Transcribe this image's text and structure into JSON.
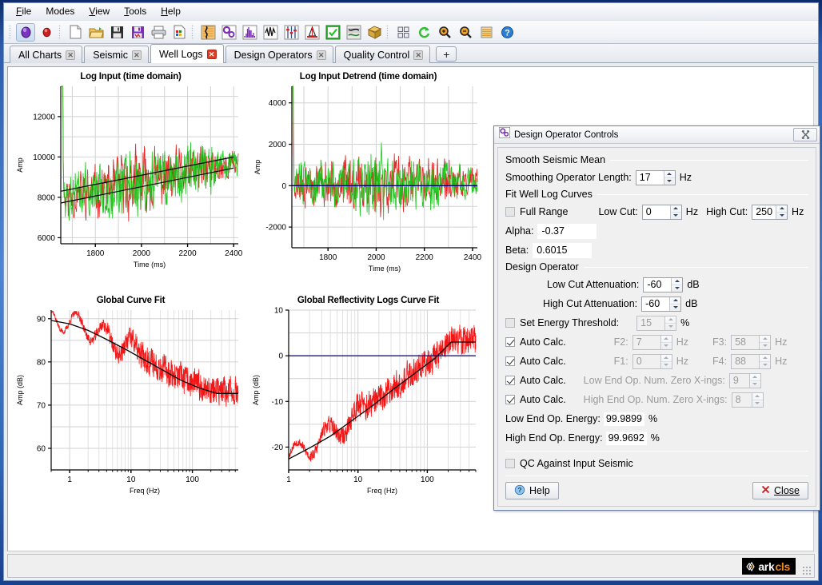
{
  "window": {
    "menubar": [
      {
        "label": "File",
        "mnemonic": "F"
      },
      {
        "label": "Modes",
        "mnemonic": ""
      },
      {
        "label": "View",
        "mnemonic": "V"
      },
      {
        "label": "Tools",
        "mnemonic": "T"
      },
      {
        "label": "Help",
        "mnemonic": "H"
      }
    ],
    "toolbar": [
      {
        "name": "record-purple-button",
        "selected": true
      },
      {
        "name": "record-red-button",
        "selected": false
      },
      {
        "name": "new-file-button",
        "selected": false
      },
      {
        "name": "open-folder-button",
        "selected": false
      },
      {
        "name": "save-button",
        "selected": false
      },
      {
        "name": "save-as-button",
        "selected": false
      },
      {
        "name": "print-button",
        "selected": false
      },
      {
        "name": "report-button",
        "selected": false
      },
      {
        "name": "seismic-trace-button",
        "selected": false
      },
      {
        "name": "settings-gears-button",
        "selected": false
      },
      {
        "name": "spectrum-button",
        "selected": false
      },
      {
        "name": "wavelet-button",
        "selected": false
      },
      {
        "name": "operator-button",
        "selected": false
      },
      {
        "name": "well-derrick-button",
        "selected": false
      },
      {
        "name": "quality-check-button",
        "selected": false
      },
      {
        "name": "design-operator-button",
        "selected": false
      },
      {
        "name": "volume-stack-button",
        "selected": false
      },
      {
        "name": "tile-layout-button",
        "selected": false
      },
      {
        "name": "refresh-button",
        "selected": false
      },
      {
        "name": "zoom-in-button",
        "selected": false
      },
      {
        "name": "zoom-out-button",
        "selected": false
      },
      {
        "name": "list-button",
        "selected": false
      },
      {
        "name": "about-help-button",
        "selected": false
      }
    ],
    "tabs": [
      {
        "label": "All Charts",
        "active": false,
        "closable": true
      },
      {
        "label": "Seismic",
        "active": false,
        "closable": true
      },
      {
        "label": "Well Logs",
        "active": true,
        "closable": true
      },
      {
        "label": "Design Operators",
        "active": false,
        "closable": true
      },
      {
        "label": "Quality Control",
        "active": false,
        "closable": true
      }
    ],
    "tab_add_label": "+",
    "statusbar": {
      "brand_part1": "ark",
      "brand_part2": "cls"
    }
  },
  "chart_data": [
    {
      "type": "line",
      "id": "log-input-time",
      "title": "Log Input (time domain)",
      "xlabel": "Time (ms)",
      "ylabel": "Amp",
      "xlim": [
        1650,
        2420
      ],
      "ylim": [
        5700,
        13500
      ],
      "xticks": [
        1800,
        2000,
        2200,
        2400
      ],
      "yticks": [
        6000,
        8000,
        10000,
        12000
      ],
      "xscale": "linear",
      "yscale": "linear",
      "grid": true,
      "series": [
        {
          "name": "log-curve-red",
          "color": "#e01b1b",
          "style": "noisy"
        },
        {
          "name": "log-curve-green",
          "color": "#16c516",
          "style": "noisy"
        },
        {
          "name": "trend-fit-upper",
          "color": "#000000",
          "style": "trend"
        },
        {
          "name": "trend-fit-lower",
          "color": "#000000",
          "style": "trend"
        }
      ],
      "trend_upper": {
        "x0": 1650,
        "y0": 8300,
        "x1": 2400,
        "y1": 10000
      },
      "trend_lower": {
        "x0": 1650,
        "y0": 7720,
        "x1": 2400,
        "y1": 9450
      }
    },
    {
      "type": "line",
      "id": "log-input-detrend",
      "title": "Log Input Detrend (time domain)",
      "xlabel": "Time (ms)",
      "ylabel": "Amp",
      "xlim": [
        1650,
        2420
      ],
      "ylim": [
        -3000,
        4800
      ],
      "xticks": [
        1800,
        2000,
        2200,
        2400
      ],
      "yticks": [
        -2000,
        0,
        2000,
        4000
      ],
      "xscale": "linear",
      "yscale": "linear",
      "grid": true,
      "series": [
        {
          "name": "detrend-red",
          "color": "#e01b1b",
          "style": "noisy"
        },
        {
          "name": "detrend-green",
          "color": "#16c516",
          "style": "noisy"
        },
        {
          "name": "zero-line",
          "color": "#000080",
          "style": "hline",
          "value": 0
        }
      ]
    },
    {
      "type": "line",
      "id": "global-curve-fit",
      "title": "Global Curve Fit",
      "xlabel": "Freq (Hz)",
      "ylabel": "Amp (dB)",
      "xlim": [
        0.5,
        560
      ],
      "ylim": [
        55,
        92
      ],
      "xticks": [
        1,
        10,
        100
      ],
      "yticks": [
        60,
        70,
        80,
        90
      ],
      "xscale": "log",
      "yscale": "linear",
      "grid": true,
      "series": [
        {
          "name": "spectrum-red",
          "color": "#f41616",
          "style": "spectrum"
        },
        {
          "name": "global-fit-black",
          "color": "#000000",
          "style": "fit"
        }
      ],
      "fit_points": [
        [
          0.5,
          89.6
        ],
        [
          1,
          88.8
        ],
        [
          2,
          87.3
        ],
        [
          4,
          85.2
        ],
        [
          8,
          83.0
        ],
        [
          16,
          80.6
        ],
        [
          32,
          78.2
        ],
        [
          64,
          75.8
        ],
        [
          128,
          74.0
        ],
        [
          250,
          72.7
        ],
        [
          560,
          72.7
        ]
      ]
    },
    {
      "type": "line",
      "id": "global-reflectivity-logs-curve-fit",
      "title": "Global Reflectivity Logs Curve Fit",
      "xlabel": "Freq (Hz)",
      "ylabel": "Amp (dB)",
      "xlim": [
        1,
        500
      ],
      "ylim": [
        -25,
        10
      ],
      "xticks": [
        1,
        10,
        100
      ],
      "yticks": [
        -20,
        -10,
        0,
        10
      ],
      "xscale": "log",
      "yscale": "linear",
      "grid": true,
      "series": [
        {
          "name": "reflectivity-red",
          "color": "#f41616",
          "style": "spectrum"
        },
        {
          "name": "reflectivity-fit-black",
          "color": "#000000",
          "style": "fit"
        },
        {
          "name": "zero-line",
          "color": "#000080",
          "style": "hline",
          "value": 0
        }
      ],
      "fit_points": [
        [
          1,
          -22.6
        ],
        [
          2,
          -20.2
        ],
        [
          4,
          -17.6
        ],
        [
          8,
          -14.3
        ],
        [
          16,
          -11.0
        ],
        [
          32,
          -7.4
        ],
        [
          64,
          -4.0
        ],
        [
          128,
          -0.6
        ],
        [
          220,
          3.0
        ],
        [
          500,
          3.0
        ]
      ]
    }
  ],
  "dialog": {
    "title": "Design Operator Controls",
    "icon": "gears-icon",
    "close_icon": "close-icon",
    "groups": {
      "smooth_seismic_mean": {
        "legend": "Smooth Seismic Mean",
        "smoothing_operator_length": {
          "label": "Smoothing Operator Length:",
          "value": "17",
          "unit": "Hz"
        }
      },
      "fit_well_log_curves": {
        "legend": "Fit Well Log Curves",
        "full_range": {
          "label": "Full Range",
          "checked": false
        },
        "low_cut": {
          "label": "Low Cut:",
          "value": "0",
          "unit": "Hz"
        },
        "high_cut": {
          "label": "High Cut:",
          "value": "250",
          "unit": "Hz"
        },
        "alpha": {
          "label": "Alpha:",
          "value": "-0.37"
        },
        "beta": {
          "label": "Beta:",
          "value": "0.6015"
        }
      },
      "design_operator": {
        "legend": "Design Operator",
        "low_cut_attenuation": {
          "label": "Low Cut Attenuation:",
          "value": "-60",
          "unit": "dB"
        },
        "high_cut_attenuation": {
          "label": "High Cut Attenuation:",
          "value": "-60",
          "unit": "dB"
        },
        "set_energy_threshold": {
          "label": "Set Energy Threshold:",
          "checked": false,
          "value": "15",
          "unit": "%",
          "enabled": false
        },
        "auto_rows": [
          {
            "auto_label": "Auto Calc.",
            "auto_checked": true,
            "left_label": "F2:",
            "left_value": "7",
            "left_unit": "Hz",
            "right_label": "F3:",
            "right_value": "58",
            "right_unit": "Hz"
          },
          {
            "auto_label": "Auto Calc.",
            "auto_checked": true,
            "left_label": "F1:",
            "left_value": "0",
            "left_unit": "Hz",
            "right_label": "F4:",
            "right_value": "88",
            "right_unit": "Hz"
          },
          {
            "auto_label": "Auto Calc.",
            "auto_checked": true,
            "left_label": "Low End Op. Num. Zero X-ings:",
            "left_value": "9",
            "left_unit": "",
            "right_label": "",
            "right_value": "",
            "right_unit": ""
          },
          {
            "auto_label": "Auto Calc.",
            "auto_checked": true,
            "left_label": "High End Op. Num. Zero X-ings:",
            "left_value": "8",
            "left_unit": "",
            "right_label": "",
            "right_value": "",
            "right_unit": ""
          }
        ],
        "low_end_energy": {
          "label": "Low End Op. Energy:",
          "value": "99.9899",
          "unit": "%"
        },
        "high_end_energy": {
          "label": "High End Op. Energy:",
          "value": "99.9692",
          "unit": "%"
        }
      },
      "qc": {
        "qc_against_input_seismic": {
          "label": "QC Against Input Seismic",
          "checked": false
        }
      }
    },
    "footer": {
      "help_label": "Help",
      "help_icon": "help-icon",
      "close_label": "Close",
      "close_icon": "x-icon"
    }
  }
}
